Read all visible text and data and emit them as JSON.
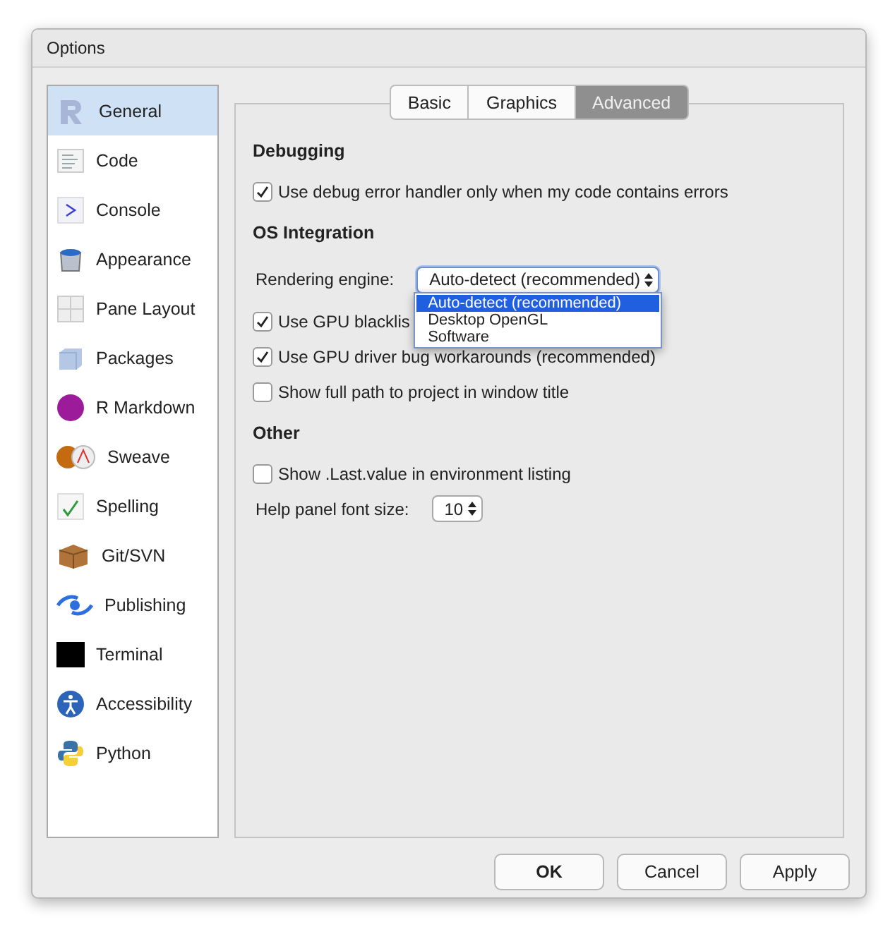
{
  "window": {
    "title": "Options"
  },
  "sidebar": {
    "items": [
      {
        "label": "General",
        "selected": true
      },
      {
        "label": "Code",
        "selected": false
      },
      {
        "label": "Console",
        "selected": false
      },
      {
        "label": "Appearance",
        "selected": false
      },
      {
        "label": "Pane Layout",
        "selected": false
      },
      {
        "label": "Packages",
        "selected": false
      },
      {
        "label": "R Markdown",
        "selected": false
      },
      {
        "label": "Sweave",
        "selected": false
      },
      {
        "label": "Spelling",
        "selected": false
      },
      {
        "label": "Git/SVN",
        "selected": false
      },
      {
        "label": "Publishing",
        "selected": false
      },
      {
        "label": "Terminal",
        "selected": false
      },
      {
        "label": "Accessibility",
        "selected": false
      },
      {
        "label": "Python",
        "selected": false
      }
    ]
  },
  "tabs": [
    {
      "label": "Basic",
      "selected": false
    },
    {
      "label": "Graphics",
      "selected": false
    },
    {
      "label": "Advanced",
      "selected": true
    }
  ],
  "sections": [
    {
      "heading": "Debugging",
      "rows": [
        {
          "kind": "checkbox",
          "label": "Use debug error handler only when my code contains errors",
          "checked": true
        }
      ]
    },
    {
      "heading": "OS Integration",
      "rows": [
        {
          "kind": "select",
          "label": "Rendering engine:",
          "value": "Auto-detect (recommended)",
          "expanded": true,
          "options": [
            {
              "label": "Auto-detect (recommended)",
              "selected": true
            },
            {
              "label": "Desktop OpenGL",
              "selected": false
            },
            {
              "label": "Software",
              "selected": false
            }
          ]
        },
        {
          "kind": "checkbox",
          "label": "Use GPU blacklis",
          "checked": true
        },
        {
          "kind": "checkbox",
          "label": "Use GPU driver bug workarounds (recommended)",
          "checked": true
        },
        {
          "kind": "checkbox",
          "label": "Show full path to project in window title",
          "checked": false
        }
      ]
    },
    {
      "heading": "Other",
      "rows": [
        {
          "kind": "checkbox",
          "label": "Show .Last.value in environment listing",
          "checked": false
        },
        {
          "kind": "select",
          "label": "Help panel font size:",
          "value": "10",
          "expanded": false
        }
      ]
    }
  ],
  "buttons": [
    "OK",
    "Cancel",
    "Apply"
  ]
}
